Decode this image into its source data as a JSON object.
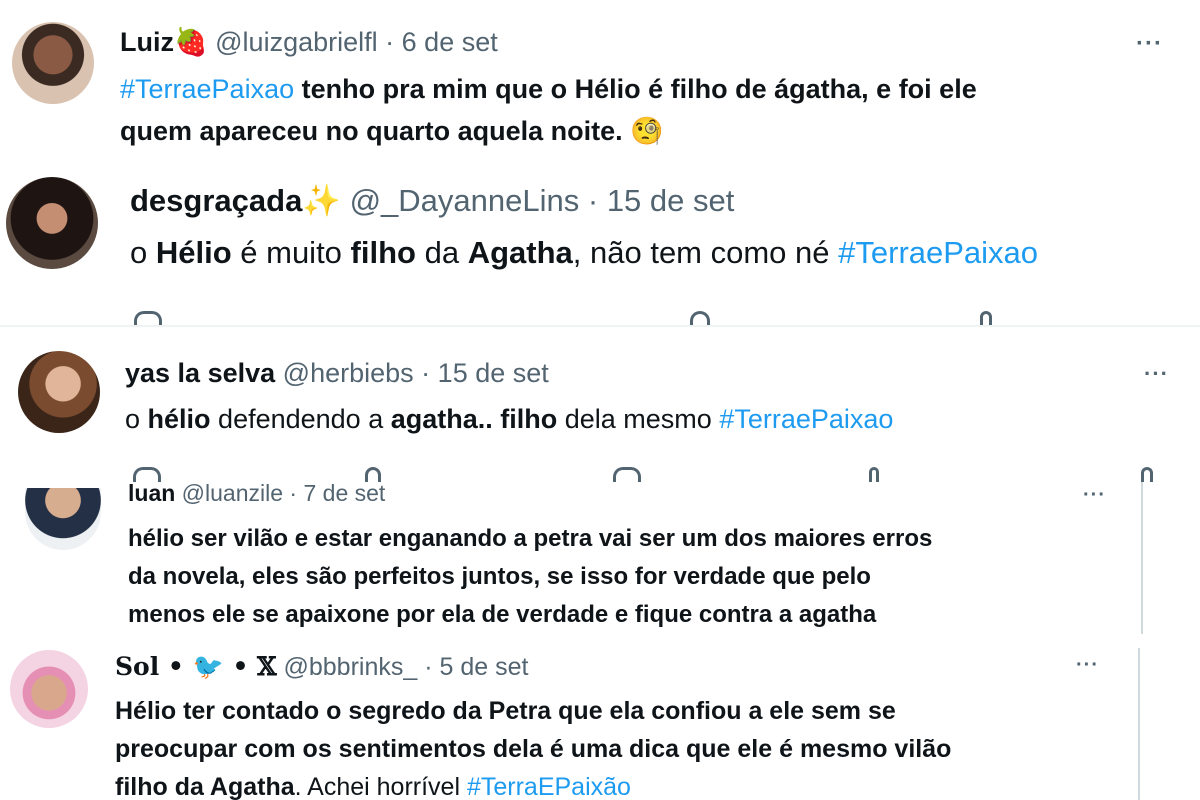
{
  "tweets": [
    {
      "name": "Luiz",
      "emoji": "🍓",
      "handle": "@luizgabrielfl",
      "dot": "·",
      "date": "6 de set",
      "more": "···",
      "line1": [
        {
          "t": "#TerraePaixao",
          "s": "tag"
        },
        {
          "t": " tenho pra mim que o Hélio é filho de ágatha, e foi ele",
          "s": "b"
        }
      ],
      "line2": [
        {
          "t": "quem apareceu no quarto aquela noite. ",
          "s": "b"
        },
        {
          "t": "🧐",
          "s": ""
        }
      ]
    },
    {
      "name": "desgraçada",
      "emoji": "✨",
      "handle": "@_DayanneLins",
      "dot": "·",
      "date": "15 de set",
      "line1": [
        {
          "t": "o ",
          "s": ""
        },
        {
          "t": "Hélio",
          "s": "b"
        },
        {
          "t": " é muito ",
          "s": ""
        },
        {
          "t": "filho",
          "s": "b"
        },
        {
          "t": " da ",
          "s": ""
        },
        {
          "t": "Agatha",
          "s": "b"
        },
        {
          "t": ", não tem como né ",
          "s": ""
        },
        {
          "t": "#TerraePaixao",
          "s": "tag"
        }
      ]
    },
    {
      "name": "yas la selva",
      "handle": "@herbiebs",
      "dot": "·",
      "date": "15 de set",
      "more": "···",
      "line1": [
        {
          "t": "o ",
          "s": ""
        },
        {
          "t": "hélio",
          "s": "b"
        },
        {
          "t": " defendendo a ",
          "s": ""
        },
        {
          "t": "agatha..",
          "s": "b"
        },
        {
          "t": " ",
          "s": ""
        },
        {
          "t": "filho",
          "s": "b"
        },
        {
          "t": " dela mesmo ",
          "s": ""
        },
        {
          "t": "#TerraePaixao",
          "s": "tag"
        }
      ]
    },
    {
      "name": "luan",
      "handle": "@luanzile",
      "dot": "·",
      "date": "7 de set",
      "more": "···",
      "line1": [
        {
          "t": "hélio ser vilão e estar enganando a petra vai ser um dos maiores erros",
          "s": "b"
        }
      ],
      "line2": [
        {
          "t": "da novela, eles são perfeitos juntos, se isso for verdade que pelo",
          "s": "b"
        }
      ],
      "line3": [
        {
          "t": "menos ele se apaixone por ela de verdade e fique contra a agatha",
          "s": "b"
        }
      ]
    },
    {
      "name": "𝐒𝐨𝐥 • 🐦 • 𝕏",
      "handle": "@bbbrinks_",
      "dot": "·",
      "date": "5 de set",
      "more": "···",
      "line1": [
        {
          "t": "Hélio ter contado o segredo da Petra que ela confiou a ele sem se",
          "s": "b"
        }
      ],
      "line2": [
        {
          "t": "preocupar com os sentimentos dela é uma dica que ele é mesmo vilão",
          "s": "b"
        }
      ],
      "line3": [
        {
          "t": "filho da Agatha",
          "s": "b"
        },
        {
          "t": ". Achei horrível ",
          "s": ""
        },
        {
          "t": "#TerraEPaixão",
          "s": "tag"
        }
      ]
    }
  ],
  "colors": {
    "link": "#1d9bf0",
    "muted": "#536471",
    "text": "#0f1419"
  }
}
